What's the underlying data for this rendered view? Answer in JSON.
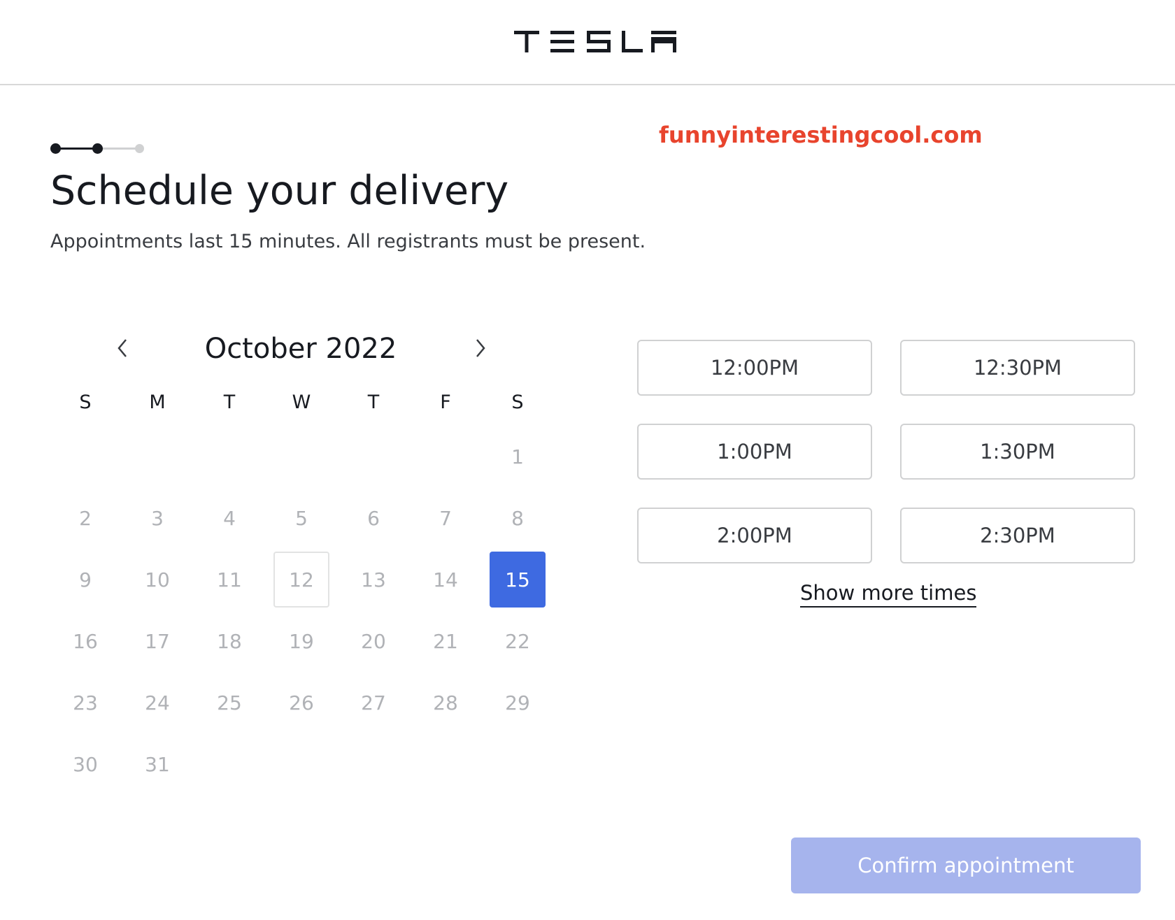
{
  "brand": {
    "logo_text": "TESLA"
  },
  "watermark": "funnyinterestingcool.com",
  "stepper": {
    "total_steps": 3,
    "current_step": 2
  },
  "title": "Schedule your delivery",
  "subtitle": "Appointments last 15 minutes. All registrants must be present.",
  "calendar": {
    "month_label": "October 2022",
    "prev_icon": "chevron-left-icon",
    "next_icon": "chevron-right-icon",
    "weekdays": [
      "S",
      "M",
      "T",
      "W",
      "T",
      "F",
      "S"
    ],
    "first_weekday_index": 6,
    "days": [
      "1",
      "2",
      "3",
      "4",
      "5",
      "6",
      "7",
      "8",
      "9",
      "10",
      "11",
      "12",
      "13",
      "14",
      "15",
      "16",
      "17",
      "18",
      "19",
      "20",
      "21",
      "22",
      "23",
      "24",
      "25",
      "26",
      "27",
      "28",
      "29",
      "30",
      "31"
    ],
    "today": "12",
    "selected": "15"
  },
  "times": {
    "slots": [
      "12:00PM",
      "12:30PM",
      "1:00PM",
      "1:30PM",
      "2:00PM",
      "2:30PM"
    ],
    "show_more_label": "Show more times"
  },
  "confirm_label": "Confirm appointment",
  "colors": {
    "accent": "#3e6ae1",
    "confirm_disabled": "#a6b4ed",
    "watermark": "#e8442d",
    "text_dark": "#171a20",
    "day_muted": "#b0b2b6"
  }
}
